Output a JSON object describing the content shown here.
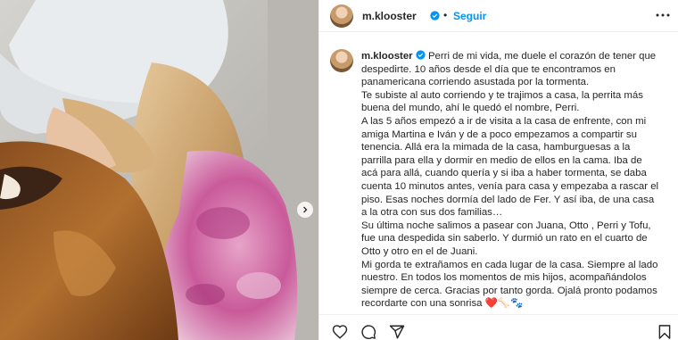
{
  "post": {
    "username": "m.klooster",
    "follow_label": "Seguir",
    "dot": "•",
    "caption_paragraphs": [
      "Perri de mi vida, me duele el corazón de tener que despedirte. 10 años desde el día que te encontramos en panamericana corriendo asustada por la tormenta.",
      "Te subiste al auto corriendo y te trajimos a casa, la perrita más buena del mundo, ahí le quedó el nombre, Perri.",
      "A las 5 años empezó a ir de visita a la casa de enfrente, con mi amiga Martina e Iván y de a poco empezamos a compartir su tenencia. Allá era la mimada de la casa, hamburguesas a la parrilla para ella y dormir en medio de ellos en la cama. Iba de acá para allá, cuando quería y si iba a haber tormenta, se daba cuenta 10 minutos antes, venía para casa y empezaba a rascar el piso. Esas noches dormía del lado de Fer. Y así iba, de una casa a la otra con sus dos familias…",
      "Su última noche salimos a pasear con Juana, Otto , Perri y Tofu, fue una despedida sin saberlo. Y durmió un rato en el cuarto de Otto y otro en el de Juani.",
      "Mi gorda te extrañamos en cada lugar de la casa. Siempre al lado nuestro. En todos los momentos de mis hijos, acompañándolos siempre de cerca. Gracias por tanto gorda. Ojalá pronto podamos recordarte con una sonrisa ❤️🦴🐾"
    ]
  },
  "icons": {
    "verified": "verified-badge-icon",
    "more": "more-options-icon",
    "like": "heart-icon",
    "comment": "comment-icon",
    "share": "share-icon",
    "save": "bookmark-icon",
    "next": "chevron-right-icon"
  },
  "colors": {
    "accent": "#0095f6",
    "text": "#262626",
    "border": "#efefef"
  }
}
